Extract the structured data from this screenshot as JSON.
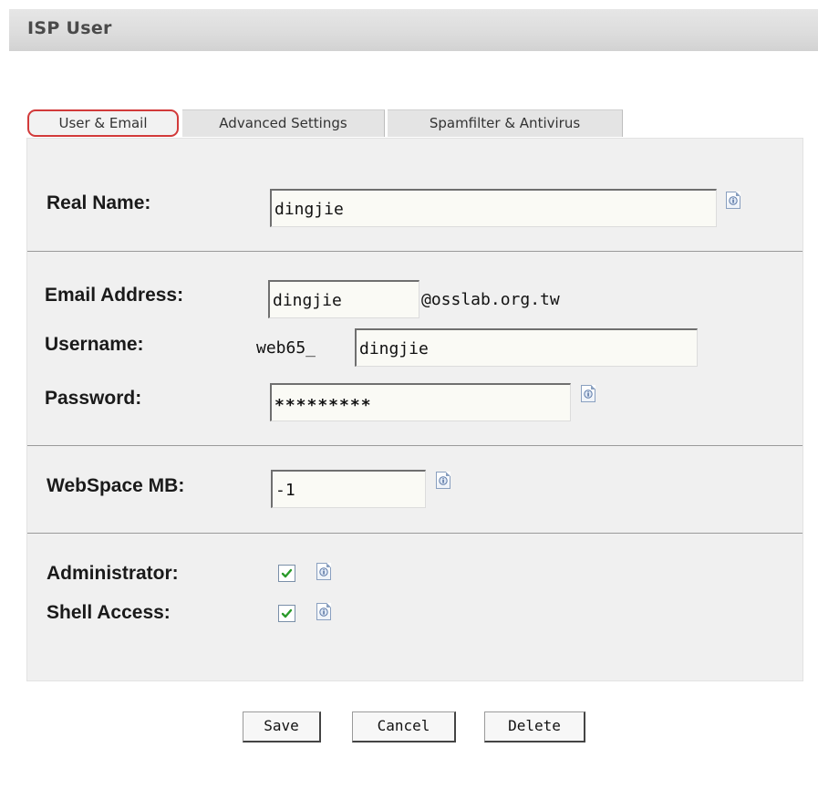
{
  "header": {
    "title": "ISP User"
  },
  "tabs": [
    {
      "label": "User & Email",
      "active": true
    },
    {
      "label": "Advanced Settings",
      "active": false
    },
    {
      "label": "Spamfilter & Antivirus",
      "active": false
    }
  ],
  "form": {
    "real_name": {
      "label": "Real Name:",
      "value": "dingjie"
    },
    "email": {
      "label": "Email Address:",
      "value": "dingjie",
      "domain": "@osslab.org.tw"
    },
    "username": {
      "label": "Username:",
      "prefix": "web65_",
      "value": "dingjie"
    },
    "password": {
      "label": "Password:",
      "value": "*********"
    },
    "webspace": {
      "label": "WebSpace MB:",
      "value": "-1"
    },
    "administrator": {
      "label": "Administrator:",
      "checked": true
    },
    "shell_access": {
      "label": "Shell Access:",
      "checked": true
    }
  },
  "buttons": {
    "save": "Save",
    "cancel": "Cancel",
    "delete": "Delete"
  },
  "colors": {
    "active_tab_outline": "#d23a3a",
    "checkmark": "#2a9a2a",
    "panel_background": "#f0f0f0"
  },
  "icons": {
    "info": "info-document-icon",
    "check": "checkmark-icon"
  }
}
